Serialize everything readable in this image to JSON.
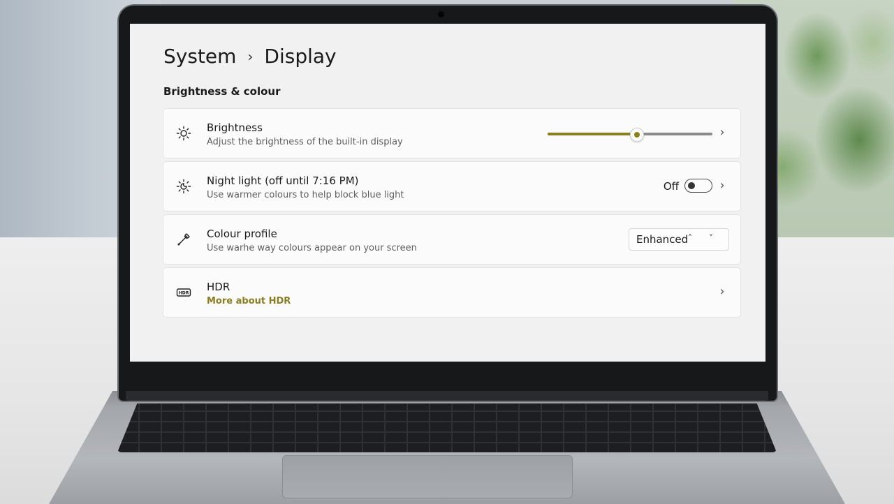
{
  "breadcrumb": {
    "parent": "System",
    "separator": "›",
    "current": "Display"
  },
  "section": {
    "title": "Brightness & colour"
  },
  "settings": {
    "brightness": {
      "icon": "sun-icon",
      "title": "Brightness",
      "subtitle": "Adjust the brightness of the built-in display",
      "level_percent": 54,
      "chevron": "›"
    },
    "night_light": {
      "icon": "night-light-icon",
      "title": "Night light (off until 7:16 PM)",
      "subtitle": "Use warmer colours to help block blue light",
      "toggle_state_label": "Off",
      "chevron": "›"
    },
    "colour_profile": {
      "icon": "eyedropper-icon",
      "title": "Colour profile",
      "subtitle": "Use warhe way colours appear on your screen",
      "selected_value": "Enhanced",
      "dropdown_arrows": "˄ ˅"
    },
    "hdr": {
      "icon": "hdr-icon",
      "title": "HDR",
      "link": "More about HDR",
      "chevron": "›"
    }
  },
  "colors": {
    "accent": "#8b7e1f",
    "screen_bg": "#f1f1f1",
    "card_bg": "#fbfbfb"
  }
}
